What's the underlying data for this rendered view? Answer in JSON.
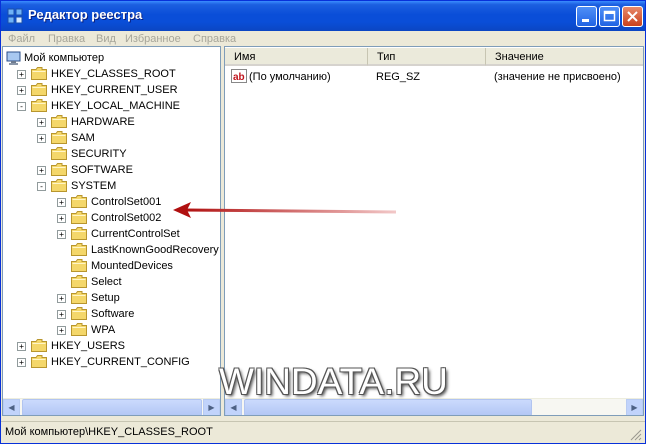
{
  "window": {
    "title": "Редактор реестра"
  },
  "menu": [
    "Файл",
    "Правка",
    "Вид",
    "Избранное",
    "Справка"
  ],
  "tree": {
    "root": "Мой компьютер",
    "nodes": [
      {
        "label": "HKEY_CLASSES_ROOT",
        "level": 1,
        "expander": "+"
      },
      {
        "label": "HKEY_CURRENT_USER",
        "level": 1,
        "expander": "+"
      },
      {
        "label": "HKEY_LOCAL_MACHINE",
        "level": 1,
        "expander": "-"
      },
      {
        "label": "HARDWARE",
        "level": 2,
        "expander": "+"
      },
      {
        "label": "SAM",
        "level": 2,
        "expander": "+"
      },
      {
        "label": "SECURITY",
        "level": 2,
        "expander": ""
      },
      {
        "label": "SOFTWARE",
        "level": 2,
        "expander": "+"
      },
      {
        "label": "SYSTEM",
        "level": 2,
        "expander": "-"
      },
      {
        "label": "ControlSet001",
        "level": 3,
        "expander": "+"
      },
      {
        "label": "ControlSet002",
        "level": 3,
        "expander": "+"
      },
      {
        "label": "CurrentControlSet",
        "level": 3,
        "expander": "+"
      },
      {
        "label": "LastKnownGoodRecovery",
        "level": 3,
        "expander": ""
      },
      {
        "label": "MountedDevices",
        "level": 3,
        "expander": ""
      },
      {
        "label": "Select",
        "level": 3,
        "expander": ""
      },
      {
        "label": "Setup",
        "level": 3,
        "expander": "+"
      },
      {
        "label": "Software",
        "level": 3,
        "expander": "+"
      },
      {
        "label": "WPA",
        "level": 3,
        "expander": "+"
      },
      {
        "label": "HKEY_USERS",
        "level": 1,
        "expander": "+"
      },
      {
        "label": "HKEY_CURRENT_CONFIG",
        "level": 1,
        "expander": "+"
      }
    ]
  },
  "list": {
    "columns": [
      "Имя",
      "Тип",
      "Значение"
    ],
    "rows": [
      {
        "name": "(По умолчанию)",
        "type": "REG_SZ",
        "value": "(значение не присвоено)",
        "icon": "ab"
      }
    ]
  },
  "status": {
    "path": "Мой компьютер\\HKEY_CLASSES_ROOT"
  },
  "watermark": "WINDATA.RU",
  "colors": {
    "arrow": "#b01010",
    "folder": "#f4d76a",
    "title_bar": "#0a4ed8"
  }
}
